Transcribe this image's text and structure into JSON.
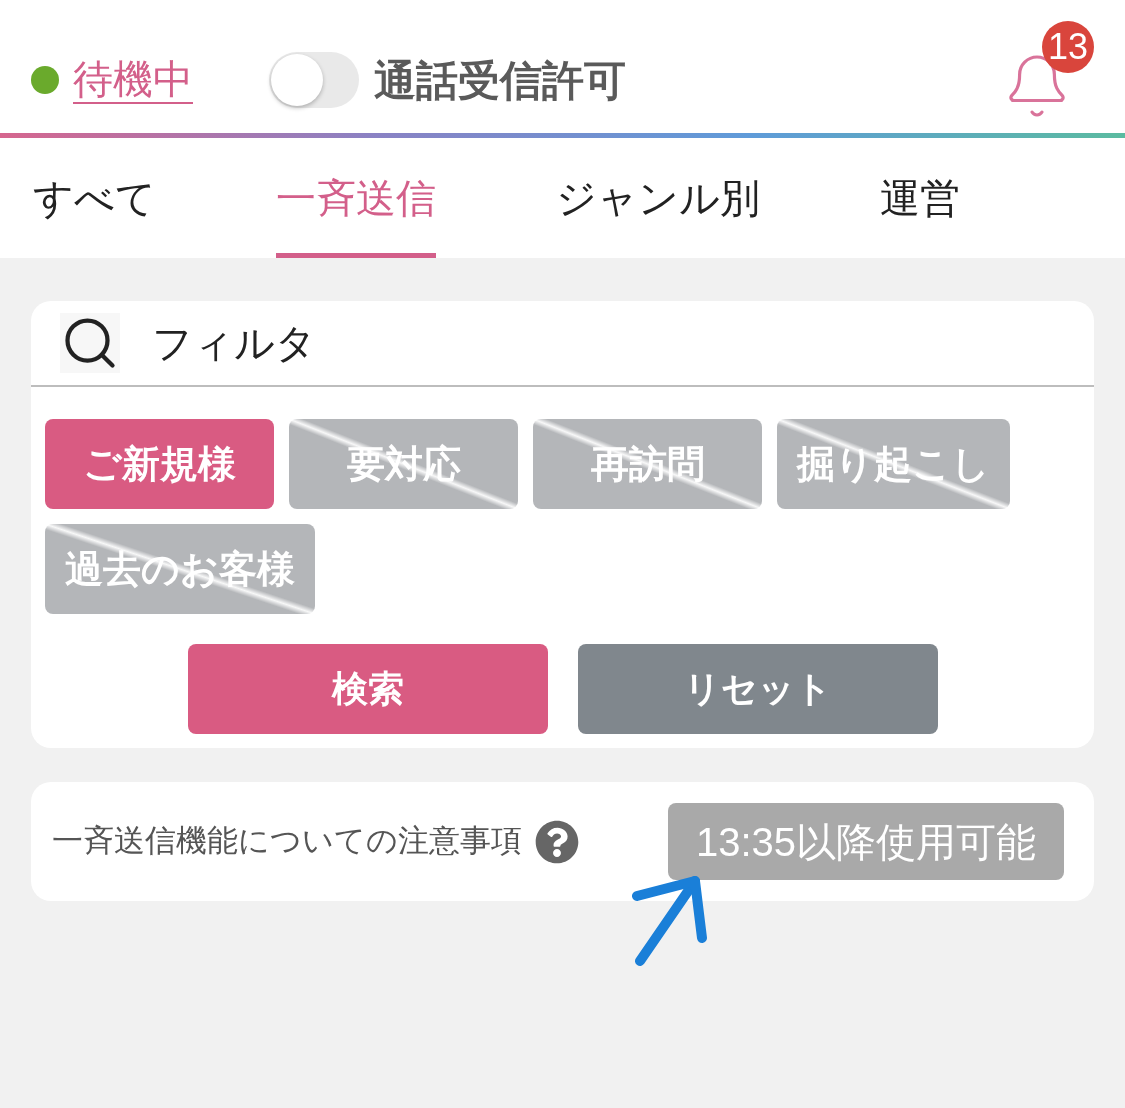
{
  "header": {
    "status": {
      "label": "待機中",
      "active": true
    },
    "call_toggle": {
      "label": "通話受信許可",
      "on": false
    },
    "notifications": {
      "count": "13"
    }
  },
  "tabs": [
    {
      "label": "すべて",
      "selected": false
    },
    {
      "label": "一斉送信",
      "selected": true
    },
    {
      "label": "ジャンル別",
      "selected": false
    },
    {
      "label": "運営",
      "selected": false
    }
  ],
  "filter": {
    "title": "フィルタ",
    "chips": [
      {
        "label": "ご新規様",
        "selected": true
      },
      {
        "label": "要対応",
        "selected": false
      },
      {
        "label": "再訪問",
        "selected": false
      },
      {
        "label": "掘り起こし",
        "selected": false
      },
      {
        "label": "過去のお客様",
        "selected": false
      }
    ],
    "buttons": [
      {
        "label": "検索",
        "kind": "primary"
      },
      {
        "label": "リセット",
        "kind": "secondary"
      }
    ]
  },
  "notice": {
    "text": "一斉送信機能についての注意事項",
    "button": {
      "label": "13:35以降使用可能",
      "disabled": true
    }
  }
}
